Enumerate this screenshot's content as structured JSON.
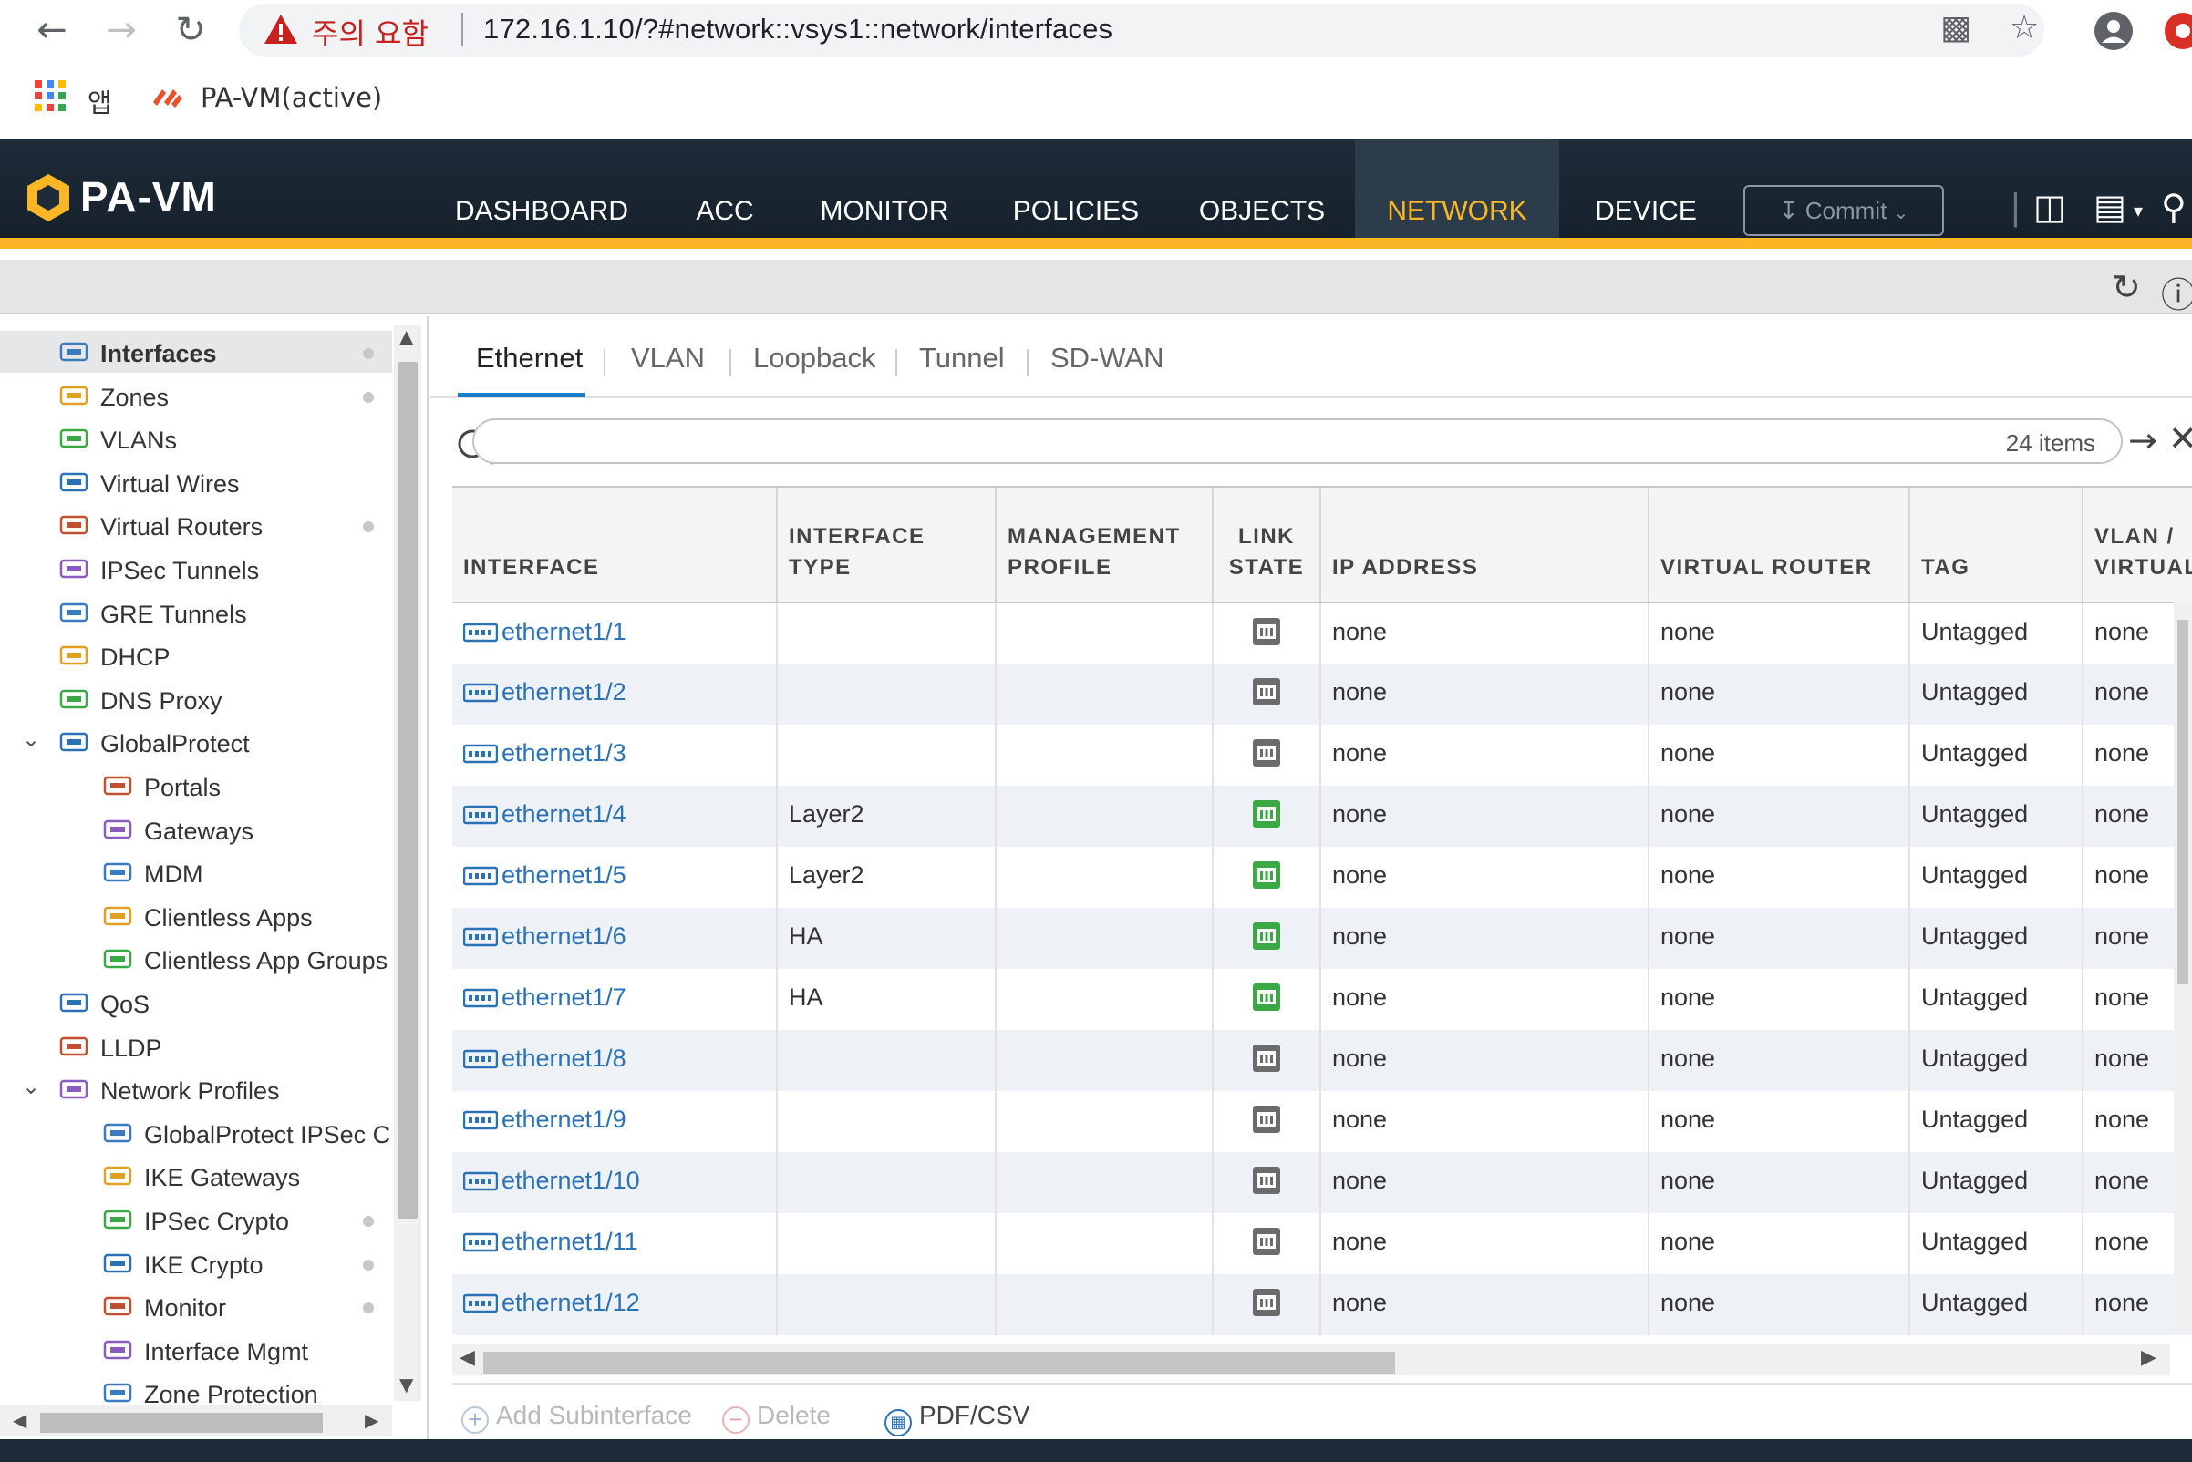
{
  "browser": {
    "warning_text": "주의 요함",
    "url": "172.16.1.10/?#network::vsys1::network/interfaces",
    "apps_label": "앱",
    "bookmark_label": "PA-VM(active)"
  },
  "header": {
    "logo_text": "PA-VM",
    "tabs": [
      "DASHBOARD",
      "ACC",
      "MONITOR",
      "POLICIES",
      "OBJECTS",
      "NETWORK",
      "DEVICE"
    ],
    "active_tab": "NETWORK",
    "commit_label": "Commit",
    "accent_color": "#fab625"
  },
  "sidebar": {
    "items": [
      {
        "label": "Interfaces",
        "icon": "interface-icon",
        "selected": true,
        "dot": true
      },
      {
        "label": "Zones",
        "icon": "zone-icon",
        "dot": true
      },
      {
        "label": "VLANs",
        "icon": "vlan-icon"
      },
      {
        "label": "Virtual Wires",
        "icon": "virtual-wire-icon"
      },
      {
        "label": "Virtual Routers",
        "icon": "router-icon",
        "dot": true
      },
      {
        "label": "IPSec Tunnels",
        "icon": "ipsec-icon"
      },
      {
        "label": "GRE Tunnels",
        "icon": "gre-icon"
      },
      {
        "label": "DHCP",
        "icon": "dhcp-icon"
      },
      {
        "label": "DNS Proxy",
        "icon": "dns-icon"
      },
      {
        "label": "GlobalProtect",
        "icon": "globalprotect-icon",
        "expanded": true
      },
      {
        "label": "Portals",
        "icon": "portal-icon",
        "child": true
      },
      {
        "label": "Gateways",
        "icon": "gateway-icon",
        "child": true
      },
      {
        "label": "MDM",
        "icon": "mdm-icon",
        "child": true
      },
      {
        "label": "Clientless Apps",
        "icon": "clientless-app-icon",
        "child": true
      },
      {
        "label": "Clientless App Groups",
        "icon": "clientless-group-icon",
        "child": true
      },
      {
        "label": "QoS",
        "icon": "qos-icon"
      },
      {
        "label": "LLDP",
        "icon": "lldp-icon"
      },
      {
        "label": "Network Profiles",
        "icon": "network-profile-icon",
        "expanded": true
      },
      {
        "label": "GlobalProtect IPSec Cry",
        "icon": "lock-icon",
        "child": true
      },
      {
        "label": "IKE Gateways",
        "icon": "ike-gateway-icon",
        "child": true
      },
      {
        "label": "IPSec Crypto",
        "icon": "lock-icon",
        "child": true,
        "dot": true
      },
      {
        "label": "IKE Crypto",
        "icon": "lock-icon",
        "child": true,
        "dot": true
      },
      {
        "label": "Monitor",
        "icon": "monitor-icon",
        "child": true,
        "dot": true
      },
      {
        "label": "Interface Mgmt",
        "icon": "interface-mgmt-icon",
        "child": true
      },
      {
        "label": "Zone Protection",
        "icon": "zone-protection-icon",
        "child": true
      }
    ]
  },
  "main": {
    "tabs": [
      "Ethernet",
      "VLAN",
      "Loopback",
      "Tunnel",
      "SD-WAN"
    ],
    "active_tab": "Ethernet",
    "search": {
      "count": "24 items",
      "placeholder": ""
    },
    "columns": [
      [
        "INTERFACE"
      ],
      [
        "INTERFACE",
        "TYPE"
      ],
      [
        "MANAGEMENT",
        "PROFILE"
      ],
      [
        "LINK",
        "STATE"
      ],
      [
        "IP ADDRESS"
      ],
      [
        "VIRTUAL ROUTER"
      ],
      [
        "TAG"
      ],
      [
        "VLAN /",
        "VIRTUAL"
      ]
    ],
    "rows": [
      {
        "interface": "ethernet1/1",
        "type": "",
        "mgmt": "",
        "link": "down",
        "ip": "none",
        "vr": "none",
        "tag": "Untagged",
        "vlan": "none"
      },
      {
        "interface": "ethernet1/2",
        "type": "",
        "mgmt": "",
        "link": "down",
        "ip": "none",
        "vr": "none",
        "tag": "Untagged",
        "vlan": "none"
      },
      {
        "interface": "ethernet1/3",
        "type": "",
        "mgmt": "",
        "link": "down",
        "ip": "none",
        "vr": "none",
        "tag": "Untagged",
        "vlan": "none"
      },
      {
        "interface": "ethernet1/4",
        "type": "Layer2",
        "mgmt": "",
        "link": "up",
        "ip": "none",
        "vr": "none",
        "tag": "Untagged",
        "vlan": "none"
      },
      {
        "interface": "ethernet1/5",
        "type": "Layer2",
        "mgmt": "",
        "link": "up",
        "ip": "none",
        "vr": "none",
        "tag": "Untagged",
        "vlan": "none"
      },
      {
        "interface": "ethernet1/6",
        "type": "HA",
        "mgmt": "",
        "link": "up",
        "ip": "none",
        "vr": "none",
        "tag": "Untagged",
        "vlan": "none"
      },
      {
        "interface": "ethernet1/7",
        "type": "HA",
        "mgmt": "",
        "link": "up",
        "ip": "none",
        "vr": "none",
        "tag": "Untagged",
        "vlan": "none"
      },
      {
        "interface": "ethernet1/8",
        "type": "",
        "mgmt": "",
        "link": "down",
        "ip": "none",
        "vr": "none",
        "tag": "Untagged",
        "vlan": "none"
      },
      {
        "interface": "ethernet1/9",
        "type": "",
        "mgmt": "",
        "link": "down",
        "ip": "none",
        "vr": "none",
        "tag": "Untagged",
        "vlan": "none"
      },
      {
        "interface": "ethernet1/10",
        "type": "",
        "mgmt": "",
        "link": "down",
        "ip": "none",
        "vr": "none",
        "tag": "Untagged",
        "vlan": "none"
      },
      {
        "interface": "ethernet1/11",
        "type": "",
        "mgmt": "",
        "link": "down",
        "ip": "none",
        "vr": "none",
        "tag": "Untagged",
        "vlan": "none"
      },
      {
        "interface": "ethernet1/12",
        "type": "",
        "mgmt": "",
        "link": "down",
        "ip": "none",
        "vr": "none",
        "tag": "Untagged",
        "vlan": "none"
      }
    ],
    "actions": {
      "add_subinterface": "Add Subinterface",
      "delete": "Delete",
      "pdf_csv": "PDF/CSV"
    },
    "link_up_color": "#3aa845",
    "link_down_color": "#6b6b6b",
    "link_color": "#2a72b5"
  }
}
